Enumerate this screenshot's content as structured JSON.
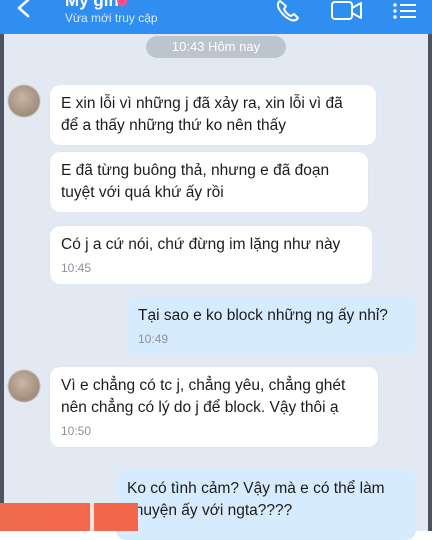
{
  "header": {
    "contact_name": "Mỹ gin",
    "status": "Vừa mới truy cập"
  },
  "date_separator": "10:43 Hôm nay",
  "messages": [
    {
      "side": "in",
      "text": "E xin lỗi vì những j đã xảy ra, xin lỗi vì đã\nđể a thấy những thứ ko nên thấy",
      "time": ""
    },
    {
      "side": "in",
      "text": "E đã từng buông thả, nhưng e đã đoạn\ntuyệt với quá khứ ấy rồi",
      "time": ""
    },
    {
      "side": "in",
      "text": "Có j a cứ nói, chứ đừng im lặng như này",
      "time": "10:45"
    },
    {
      "side": "out",
      "text": "Tại sao e ko block những ng ấy nhỉ?",
      "time": "10:49"
    },
    {
      "side": "in",
      "text": "Vì e chẳng có tc j, chẳng yêu, chẳng ghét\nnên chẳng có lý do j để block. Vậy thôi ạ",
      "time": "10:50"
    },
    {
      "side": "out",
      "text": "Ko có tình cảm? Vậy mà e có thể làm\nchuyện ấy với ngta????",
      "time": ""
    }
  ],
  "colors": {
    "header": "#2f8ef0",
    "chat_background": "#e2e9f2",
    "incoming_bubble": "#ffffff",
    "outgoing_bubble": "#d6ecfe"
  },
  "icons": [
    "back-icon",
    "call-icon",
    "video-call-icon",
    "menu-icon"
  ]
}
